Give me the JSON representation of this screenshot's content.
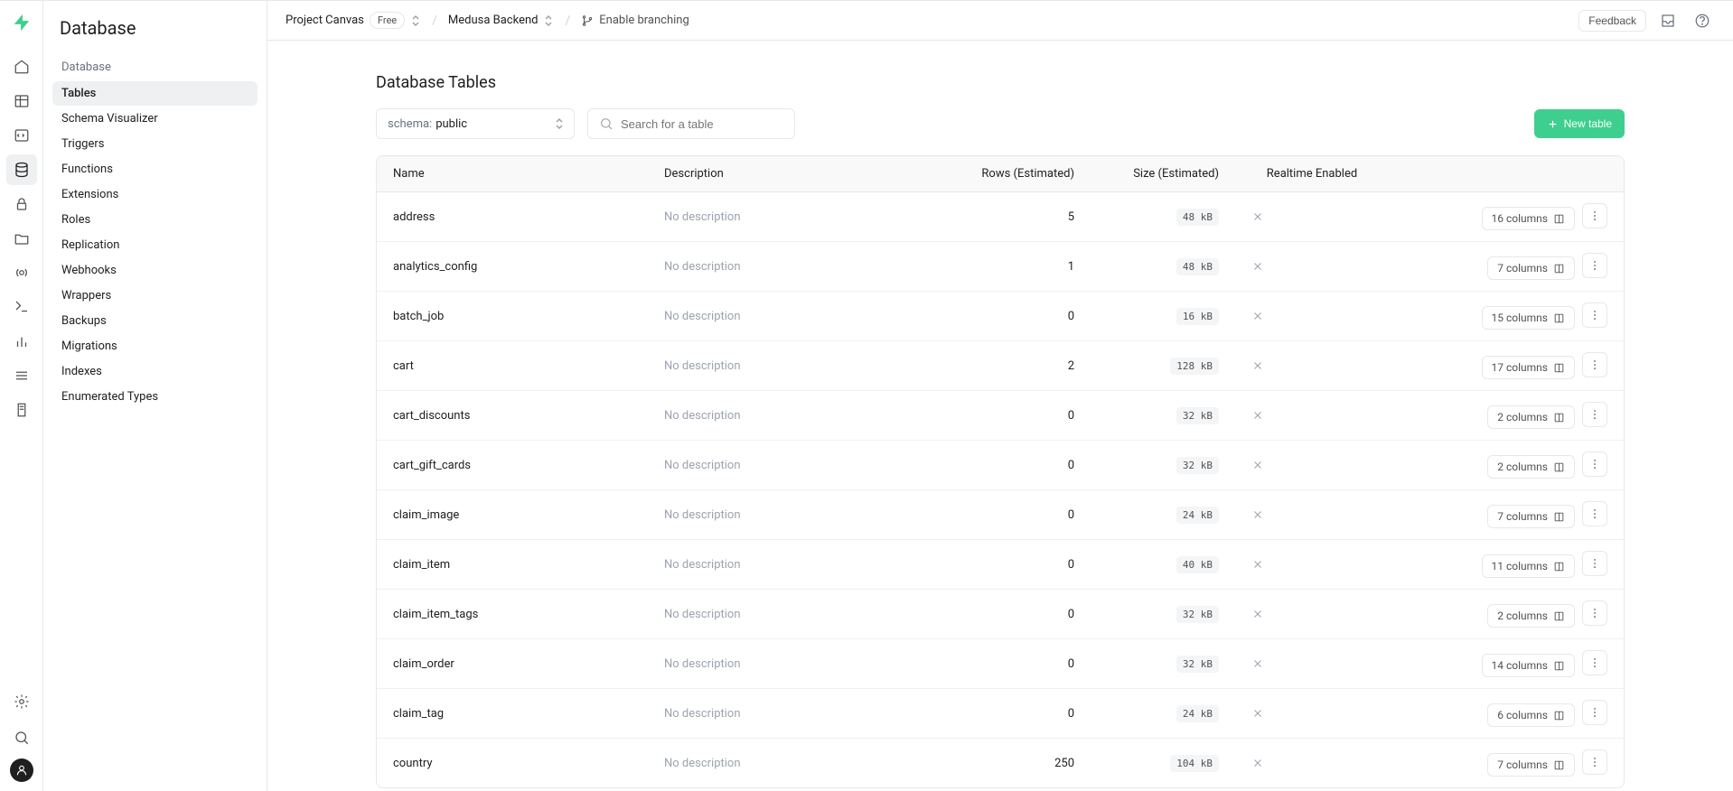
{
  "iconbar": {
    "items": [
      "home",
      "table-editor",
      "sql-editor",
      "database",
      "auth",
      "storage",
      "realtime",
      "edge-functions",
      "reports",
      "logs",
      "docs"
    ]
  },
  "sidebar": {
    "title": "Database",
    "section_label": "Database",
    "items": [
      {
        "label": "Tables"
      },
      {
        "label": "Schema Visualizer"
      },
      {
        "label": "Triggers"
      },
      {
        "label": "Functions"
      },
      {
        "label": "Extensions"
      },
      {
        "label": "Roles"
      },
      {
        "label": "Replication"
      },
      {
        "label": "Webhooks"
      },
      {
        "label": "Wrappers"
      },
      {
        "label": "Backups"
      },
      {
        "label": "Migrations"
      },
      {
        "label": "Indexes"
      },
      {
        "label": "Enumerated Types"
      }
    ]
  },
  "topbar": {
    "org": "Project Canvas",
    "plan": "Free",
    "project": "Medusa Backend",
    "branching": "Enable branching",
    "feedback": "Feedback"
  },
  "page": {
    "title": "Database Tables",
    "schema_label": "schema:",
    "schema_value": "public",
    "search_placeholder": "Search for a table",
    "new_table": "New table"
  },
  "table": {
    "headers": {
      "name": "Name",
      "description": "Description",
      "rows": "Rows (Estimated)",
      "size": "Size (Estimated)",
      "realtime": "Realtime Enabled",
      "actions": ""
    },
    "no_description": "No description",
    "columns_suffix": "columns",
    "rows": [
      {
        "name": "address",
        "rows": "5",
        "size": "48 kB",
        "cols": "16"
      },
      {
        "name": "analytics_config",
        "rows": "1",
        "size": "48 kB",
        "cols": "7"
      },
      {
        "name": "batch_job",
        "rows": "0",
        "size": "16 kB",
        "cols": "15"
      },
      {
        "name": "cart",
        "rows": "2",
        "size": "128 kB",
        "cols": "17"
      },
      {
        "name": "cart_discounts",
        "rows": "0",
        "size": "32 kB",
        "cols": "2"
      },
      {
        "name": "cart_gift_cards",
        "rows": "0",
        "size": "32 kB",
        "cols": "2"
      },
      {
        "name": "claim_image",
        "rows": "0",
        "size": "24 kB",
        "cols": "7"
      },
      {
        "name": "claim_item",
        "rows": "0",
        "size": "40 kB",
        "cols": "11"
      },
      {
        "name": "claim_item_tags",
        "rows": "0",
        "size": "32 kB",
        "cols": "2"
      },
      {
        "name": "claim_order",
        "rows": "0",
        "size": "32 kB",
        "cols": "14"
      },
      {
        "name": "claim_tag",
        "rows": "0",
        "size": "24 kB",
        "cols": "6"
      },
      {
        "name": "country",
        "rows": "250",
        "size": "104 kB",
        "cols": "7"
      }
    ]
  }
}
